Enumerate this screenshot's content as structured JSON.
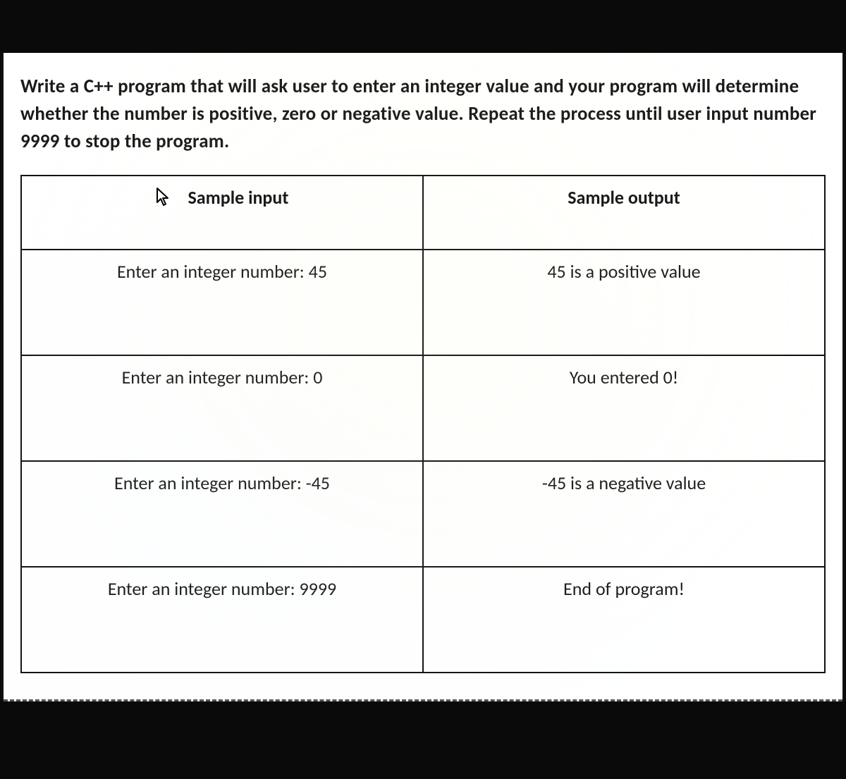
{
  "problem": {
    "prefix": "Write a C++ program that will ask user to enter an integer value and your program will determine whether the number is ",
    "kw1": "positive",
    "sep1": ", ",
    "kw2": "zero",
    "sep2": " or ",
    "kw3": "negative",
    "mid": " value. Repeat the process until user input number ",
    "sentinel": "9999",
    "suffix": " to stop the program."
  },
  "table": {
    "headers": {
      "input": "Sample input",
      "output": "Sample output"
    },
    "rows": [
      {
        "input": "Enter an integer number: 45",
        "output": "45 is a positive value"
      },
      {
        "input": "Enter an integer number: 0",
        "output": "You entered 0!"
      },
      {
        "input": "Enter an integer number: -45",
        "output": "-45 is a negative value"
      },
      {
        "input": "Enter an integer number: 9999",
        "output": "End of program!"
      }
    ]
  }
}
